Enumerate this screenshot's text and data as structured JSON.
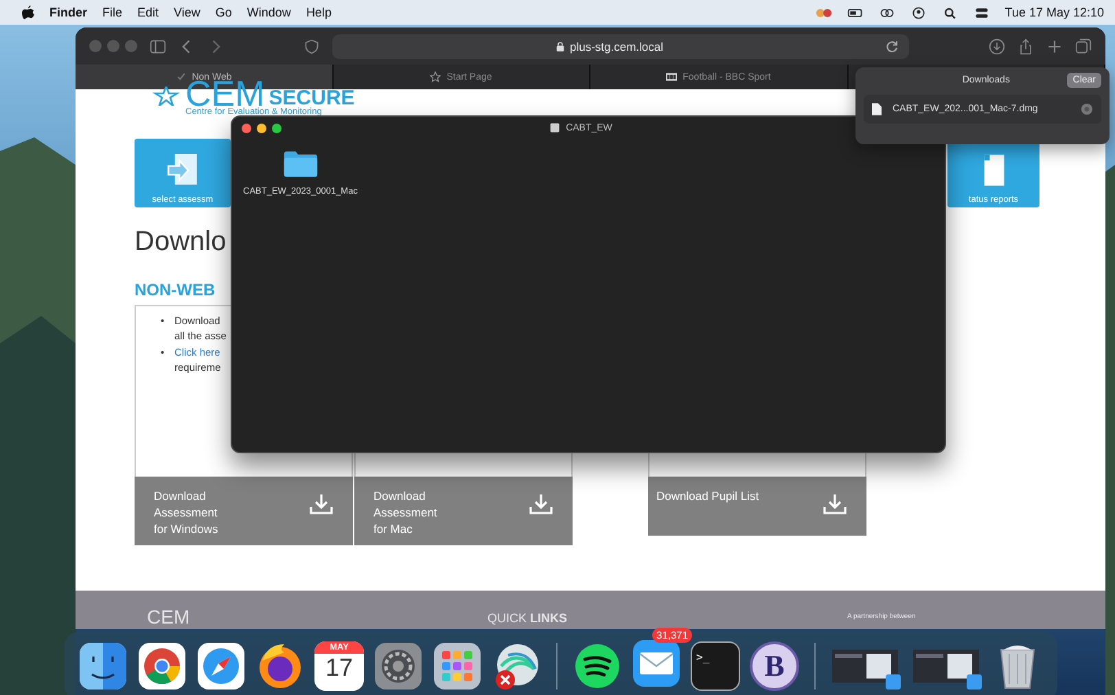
{
  "menu_bar": {
    "app": "Finder",
    "menus": [
      "File",
      "Edit",
      "View",
      "Go",
      "Window",
      "Help"
    ],
    "clock": "Tue 17 May 12:10"
  },
  "browser": {
    "address": "plus-stg.cem.local",
    "tabs": [
      {
        "label": "Non Web",
        "kind": "check",
        "selected": true
      },
      {
        "label": "Start Page",
        "kind": "star",
        "selected": false
      },
      {
        "label": "Football - BBC Sport",
        "kind": "site",
        "selected": false
      }
    ]
  },
  "page": {
    "logo": {
      "mark": "CEM",
      "product": "SECURE",
      "tagline": "Centre for Evaluation & Monitoring"
    },
    "tiles": [
      {
        "label": "select assessm",
        "kind": "arrow"
      },
      {
        "label": "tatus reports",
        "kind": "page"
      }
    ],
    "heading": "Downlo",
    "section": "NON-WEB",
    "bullets": [
      {
        "kind": "text",
        "marker": "•",
        "lines": [
          "Download",
          "all the asse"
        ]
      },
      {
        "kind": "link",
        "marker": "•",
        "lines": [
          "Click here"
        ]
      }
    ],
    "bullet_tail": "requireme",
    "downloads": [
      {
        "lines": [
          "Download",
          "Assessment",
          "for Windows"
        ]
      },
      {
        "lines": [
          "Download",
          "Assessment",
          "for Mac"
        ]
      },
      {
        "lines": [
          "Download Pupil List"
        ]
      }
    ],
    "footer": {
      "logo": "CEM",
      "links_title": "QUICK **LINKS**",
      "partnership": "A partnership between"
    }
  },
  "finder": {
    "title": "CABT_EW",
    "items": [
      {
        "name": "CABT_EW_2023_0001_Mac"
      }
    ]
  },
  "downloads_popover": {
    "title": "Downloads",
    "clear": "Clear",
    "items": [
      {
        "name": "CABT_EW_202...001_Mac-7.dmg"
      }
    ]
  },
  "dock": {
    "apps": [
      {
        "kind": "finder"
      },
      {
        "kind": "chrome"
      },
      {
        "kind": "safari"
      },
      {
        "kind": "firefox"
      },
      {
        "kind": "calendar",
        "month": "MAY",
        "day": "17"
      },
      {
        "kind": "settings"
      },
      {
        "kind": "launchpad"
      },
      {
        "kind": "network"
      },
      {
        "kind": "divider"
      },
      {
        "kind": "spotify"
      },
      {
        "kind": "mail",
        "badge": "31,371"
      },
      {
        "kind": "terminal",
        "prompt": ">_"
      },
      {
        "kind": "bbedit",
        "letter": "B"
      },
      {
        "kind": "divider"
      },
      {
        "kind": "window"
      },
      {
        "kind": "window"
      },
      {
        "kind": "trash"
      }
    ]
  }
}
